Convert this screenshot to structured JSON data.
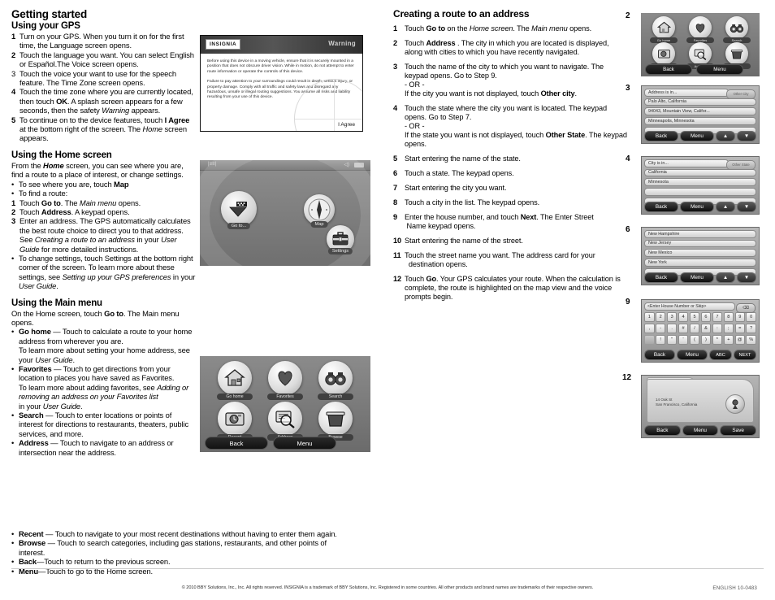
{
  "left_column": {
    "title": "Getting started",
    "gps_section": {
      "heading": "Using your GPS",
      "steps": [
        {
          "num": "1",
          "text": "Turn on your GPS. When you turn it on for the first time, the Language screen opens."
        },
        {
          "num": "2",
          "text": "Touch the language you want. You can select English or Español.The Voice screen opens."
        },
        {
          "num": "3",
          "text": "Touch the voice your want to use for the speech feature. The Time Zone screen opens."
        },
        {
          "num": "4",
          "text": "Touch the time zone where you are currently located, then touch OK. A splash screen appears for a few seconds, then the safety Warning appears."
        },
        {
          "num": "5",
          "text": "To continue on to the device features, touch I Agree at the bottom right of the screen. The Home screen appears."
        }
      ]
    },
    "home_section": {
      "heading": "Using the Home screen",
      "intro": "From the Home screen, you can see where you are, find a route to a place of interest, or change settings.",
      "bullets_top": [
        "To see where you are, touch Map",
        "To find a route:"
      ],
      "steps": [
        {
          "num": "1",
          "text": "Touch Go to. The Main menu opens."
        },
        {
          "num": "2",
          "text": "Touch Address. A keypad opens."
        },
        {
          "num": "3",
          "text": "Enter an address. The GPS automatically calculates the best route choice to direct you to that address. See Creating a route to an address in your User Guide for more detailed instructions."
        }
      ],
      "bullets_bottom": [
        "To change settings, touch  Settings  at the bottom right corner of the screen. To learn more about these settings, see Setting up your GPS preferences in your User Guide."
      ]
    },
    "menu_section": {
      "heading": "Using the Main menu",
      "intro": "On the Home screen, touch Go to. The Main menu opens.",
      "items": [
        {
          "term": "Go home",
          "desc": " — Touch to calculate a route to your home address from wherever you are. To learn more about setting your home address, see your User Guide."
        },
        {
          "term": "Favorites",
          "desc": " — Touch to get directions from your location to places you have saved as Favorites. To learn more about adding favorites, see Adding or removing an address on your Favorites list in your User Guide."
        },
        {
          "term": "Search",
          "desc": " — Touch to enter locations or points of interest for directions to restaurants, theaters, public services, and more."
        },
        {
          "term": "Address",
          "desc": " — Touch to navigate to an address or intersection near the address."
        },
        {
          "term": "Recent",
          "desc": " — Touch to navigate to your most recent destinations without having to enter them again."
        },
        {
          "term": "Browse",
          "desc": " — Touch to search categories, including gas stations, restaurants, and other points of interest."
        },
        {
          "term": "Back",
          "desc": "—Touch to return to the previous screen."
        },
        {
          "term": "Menu",
          "desc": "—Touch to go to the Home screen."
        }
      ]
    }
  },
  "right_column": {
    "title": "Creating a route to an address",
    "steps": [
      {
        "num": "1",
        "text": "Touch Go to on the Home screen. The Main menu opens."
      },
      {
        "num": "2",
        "text": "Touch Address . The city in which you are located is displayed, along with cities to which you have recently navigated."
      },
      {
        "num": "3",
        "text": "Touch the name of the city to which you want to navigate. The keypad opens. Go to Step 9.",
        "or": "- OR -",
        "alt": "If the city you want is not displayed, touch Other city."
      },
      {
        "num": "4",
        "text": "Touch the state where the city you want is located. The keypad opens. Go to Step 7.",
        "or": "- OR -",
        "alt": "If the state you want is not displayed, touch Other State. The keypad opens."
      },
      {
        "num": "5",
        "text": "Start entering the name of the state."
      },
      {
        "num": "6",
        "text": "Touch a state. The keypad opens."
      },
      {
        "num": "7",
        "text": "Start entering the city you want."
      },
      {
        "num": "8",
        "text": "Touch a city in the list. The keypad opens."
      },
      {
        "num": "9",
        "text": "Enter the house number, and touch Next. The Enter Street Name keypad opens."
      },
      {
        "num": "10",
        "text": "Start entering the name of the street."
      },
      {
        "num": "11",
        "text": "Touch the street name you want. The address card for your destination opens."
      },
      {
        "num": "12",
        "text": "Touch Go. Your GPS calculates your route. When the calculation is complete, the route is highlighted on the map view and the voice prompts begin."
      }
    ]
  },
  "warning_dialog": {
    "brand": "INSIGNIA",
    "title": "Warning",
    "paragraph1": "Before using this device in a moving vehicle, ensure that it is securely mounted in a position that does not obscure driver vision. While in motion, do not attempt to enter route information or operate the controls of this device.",
    "paragraph2": "Failure to pay attention to your surroundings could result in death, serious injury, or property damage. Comply with all traffic and safety laws and disregard any hazardous, unsafe or illegal routing suggestions.  You assume all risks and liability resulting from your use of this device.",
    "agree_button": "I Agree"
  },
  "home_screen": {
    "goto_label": "Go to...",
    "map_label": "Map",
    "settings_label": "Settings"
  },
  "main_menu_screen": {
    "icons": [
      {
        "label": "Go home",
        "icon": "house-icon"
      },
      {
        "label": "Favorites",
        "icon": "heart-icon"
      },
      {
        "label": "Search",
        "icon": "binoculars-icon"
      },
      {
        "label": "Recent",
        "icon": "clock-camera-icon"
      },
      {
        "label": "Address",
        "icon": "magnifier-card-icon"
      },
      {
        "label": "Browse",
        "icon": "basket-icon"
      }
    ],
    "back_label": "Back",
    "menu_label": "Menu"
  },
  "device_panels": {
    "panel_3": {
      "step": "3",
      "field": "Address is in...",
      "other_button": "Other City",
      "rows": [
        "Palo Alto, California",
        "94043, Mountain View, Califor...",
        "Minneapolis, Minnesota",
        ""
      ],
      "back": "Back",
      "menu": "Menu"
    },
    "panel_4": {
      "step": "4",
      "field": "City is in...",
      "other_button": "Other State",
      "rows": [
        "California",
        "Minnesota",
        "",
        ""
      ],
      "back": "Back",
      "menu": "Menu"
    },
    "panel_6": {
      "step": "6",
      "rows": [
        "New Hampshire",
        "New Jersey",
        "New Mexico",
        "New York",
        ""
      ],
      "back": "Back",
      "menu": "Menu"
    },
    "panel_9": {
      "step": "9",
      "field": "<Enter House Number or Skip>",
      "delete_icon": "backspace-icon",
      "keys_row1": [
        "1",
        "2",
        "3",
        "4",
        "5",
        "6",
        "7",
        "8",
        "9",
        "0"
      ],
      "keys_row2": [
        ",",
        "-",
        ".",
        "#",
        "/",
        "&",
        ":",
        ";",
        "=",
        "?"
      ],
      "keys_row3": [
        "",
        "!",
        "\"",
        "'",
        "(",
        ")",
        "*",
        "+",
        "@",
        "%"
      ],
      "back": "Back",
      "menu": "Menu",
      "abc": "ABC",
      "next": "NEXT"
    },
    "panel_12": {
      "step": "12",
      "address_line1": "14 Oak St",
      "address_line2": "San Francisco, California",
      "back": "Back",
      "menu": "Menu",
      "save": "Save"
    },
    "panel_2_step": "2"
  },
  "footer": {
    "copyright": "© 2010 BBY Solutions, Inc., Inc. All rights reserved. INSIGNIA is a trademark of BBY Solutions, Inc. Registered in some countries. All other products and brand names are trademarks of their respective owners.",
    "code": "ENGLISH 10-0483"
  }
}
